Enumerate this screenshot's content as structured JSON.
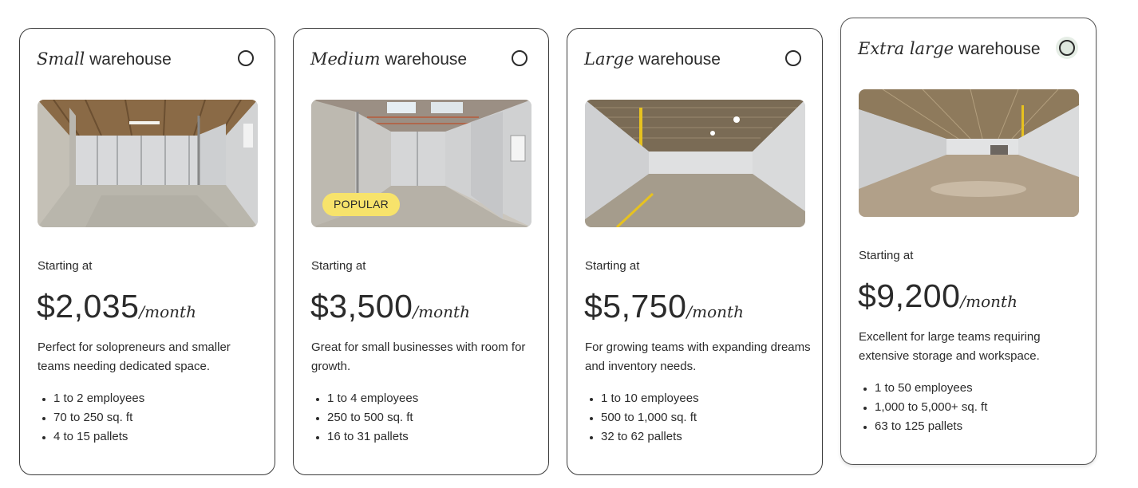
{
  "cards": [
    {
      "size": "Small",
      "suffix": "warehouse",
      "starting_label": "Starting at",
      "price": "$2,035",
      "per": "/month",
      "description": "Perfect for solopreneurs and smaller teams needing dedicated space.",
      "features": [
        "1 to 2 employees",
        "70 to 250 sq. ft",
        "4 to 15 pallets"
      ],
      "selected": false,
      "badge": ""
    },
    {
      "size": "Medium",
      "suffix": "warehouse",
      "starting_label": "Starting at",
      "price": "$3,500",
      "per": "/month",
      "description": "Great for small businesses with room for growth.",
      "features": [
        "1 to 4 employees",
        "250 to 500 sq. ft",
        "16 to 31 pallets"
      ],
      "selected": false,
      "badge": "POPULAR"
    },
    {
      "size": "Large",
      "suffix": "warehouse",
      "starting_label": "Starting at",
      "price": "$5,750",
      "per": "/month",
      "description": "For growing teams with expanding dreams and inventory needs.",
      "features": [
        "1 to 10 employees",
        "500 to 1,000 sq. ft",
        "32 to 62 pallets"
      ],
      "selected": false,
      "badge": ""
    },
    {
      "size": "Extra large",
      "suffix": "warehouse",
      "starting_label": "Starting at",
      "price": "$9,200",
      "per": "/month",
      "description": "Excellent for large teams requiring extensive storage and workspace.",
      "features": [
        "1 to 50 employees",
        "1,000 to 5,000+ sq. ft",
        "63 to 125 pallets"
      ],
      "selected": false,
      "badge": ""
    }
  ],
  "colors": {
    "text": "#2b2b2b",
    "border": "#3a3a3a",
    "badge_bg": "#f7e36b",
    "hover_radio_bg": "#dfe8df"
  }
}
